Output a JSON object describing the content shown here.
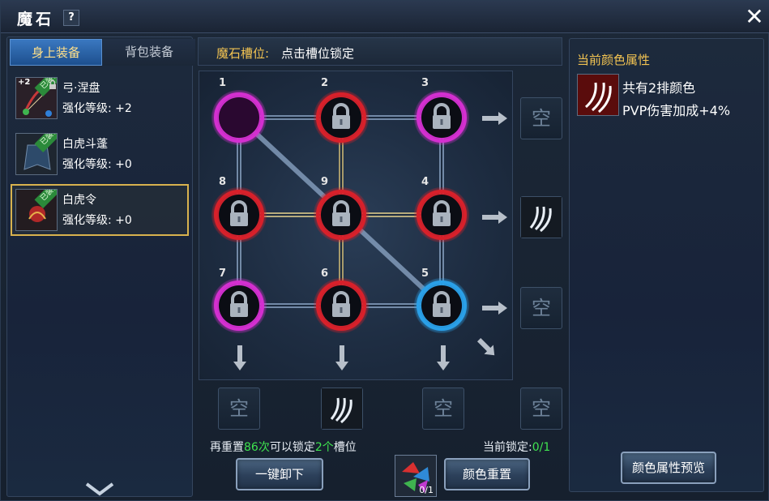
{
  "window": {
    "title": "魔石",
    "help": "?",
    "close": "✕"
  },
  "tabs": {
    "equipped": "身上装备",
    "bag": "背包装备"
  },
  "equipment": [
    {
      "name": "弓·涅盘",
      "level": "强化等级: +2",
      "badge": "已装备",
      "plus": "+2"
    },
    {
      "name": "白虎斗蓬",
      "level": "强化等级: +0",
      "badge": "已装备"
    },
    {
      "name": "白虎令",
      "level": "强化等级: +0",
      "badge": "已装备"
    }
  ],
  "slots_header": {
    "label": "魔石槽位:",
    "hint": "点击槽位锁定"
  },
  "grid": {
    "slots": [
      {
        "num": "1",
        "color": "purple",
        "locked": false
      },
      {
        "num": "2",
        "color": "red",
        "locked": true
      },
      {
        "num": "3",
        "color": "purple",
        "locked": true
      },
      {
        "num": "8",
        "color": "red",
        "locked": true
      },
      {
        "num": "9",
        "color": "red",
        "locked": true
      },
      {
        "num": "4",
        "color": "red",
        "locked": true
      },
      {
        "num": "7",
        "color": "purple",
        "locked": true
      },
      {
        "num": "6",
        "color": "red",
        "locked": true
      },
      {
        "num": "5",
        "color": "blue",
        "locked": true
      }
    ],
    "row_results": [
      "空",
      "filled",
      "空"
    ],
    "col_results": [
      "空",
      "filled",
      "空",
      "空"
    ],
    "empty_label": "空"
  },
  "status": {
    "reset_prefix": "再重置",
    "reset_count": "86次",
    "reset_mid": "可以锁定",
    "lock_count": "2个",
    "reset_suffix": "槽位",
    "current_lock_label": "当前锁定:",
    "current_lock_value": "0/1"
  },
  "buttons": {
    "unload_all": "一键卸下",
    "color_reset": "颜色重置",
    "preview": "颜色属性预览"
  },
  "reset_item_count": "0/1",
  "right": {
    "title": "当前颜色属性",
    "line1": "共有2排颜色",
    "line2": "PVP伤害加成+4%"
  },
  "colors": {
    "purple": "#d42fd0",
    "red": "#d8202a",
    "blue": "#2aa0e8",
    "accent": "#f2c352",
    "green": "#3fe34f"
  }
}
